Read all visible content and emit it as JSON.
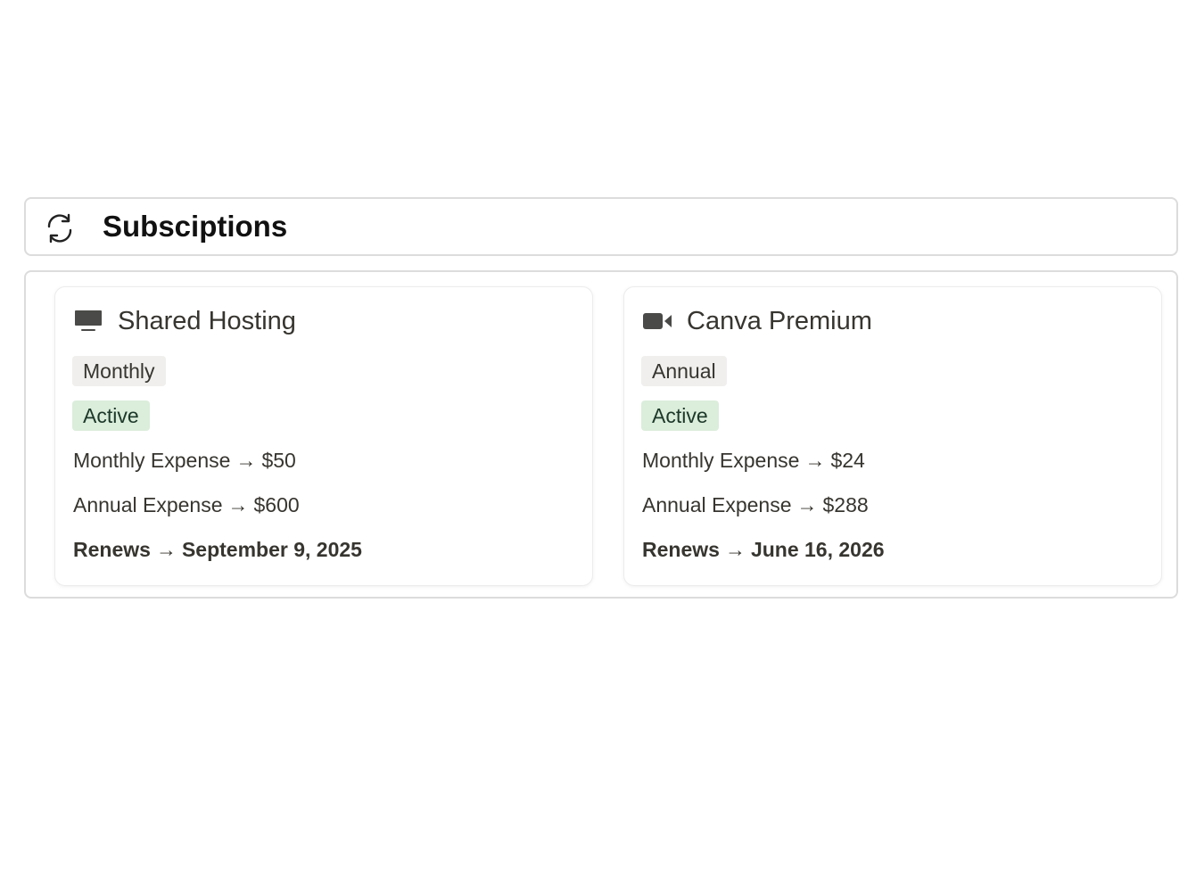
{
  "header": {
    "title": "Subsciptions",
    "icon": "refresh-icon"
  },
  "cards": [
    {
      "icon": "monitor-icon",
      "title": "Shared Hosting",
      "billing": "Monthly",
      "status": "Active",
      "monthly_label": "Monthly Expense",
      "monthly_value": "$50",
      "annual_label": "Annual Expense",
      "annual_value": "$600",
      "renews_label": "Renews",
      "renews_value": "September 9, 2025"
    },
    {
      "icon": "video-camera-icon",
      "title": "Canva Premium",
      "billing": "Annual",
      "status": "Active",
      "monthly_label": "Monthly Expense",
      "monthly_value": "$24",
      "annual_label": "Annual Expense",
      "annual_value": "$288",
      "renews_label": "Renews",
      "renews_value": "June 16, 2026"
    }
  ],
  "arrow": "→",
  "colors": {
    "status_bg": "#dbeddb",
    "status_text": "#1c3829",
    "billing_bg": "#f0efed",
    "text": "#37352f",
    "border": "#dcdcdc"
  }
}
